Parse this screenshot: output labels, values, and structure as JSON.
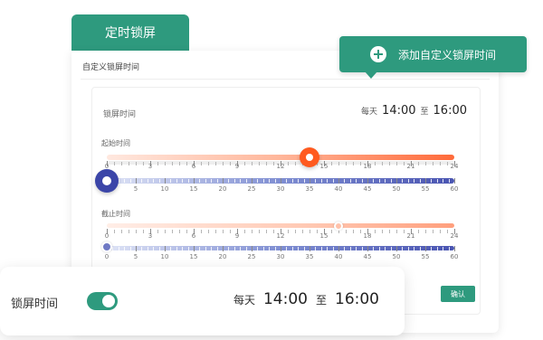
{
  "tab": {
    "title": "定时锁屏"
  },
  "section": {
    "title": "自定义锁屏时间"
  },
  "panel": {
    "label": "锁屏时间",
    "daily": "每天",
    "start": "14:00",
    "to": "至",
    "end": "16:00"
  },
  "start_slider": {
    "title": "起始时间",
    "hour_ticks": [
      "0",
      "3",
      "6",
      "9",
      "12",
      "15",
      "18",
      "21",
      "24"
    ],
    "minute_ticks": [
      "0",
      "5",
      "10",
      "15",
      "20",
      "25",
      "30",
      "35",
      "40",
      "45",
      "50",
      "55",
      "60"
    ],
    "hour_value": 14,
    "minute_value": 0
  },
  "end_slider": {
    "title": "截止时间",
    "hour_ticks": [
      "0",
      "3",
      "6",
      "9",
      "12",
      "15",
      "18",
      "21",
      "24"
    ],
    "minute_ticks": [
      "0",
      "5",
      "10",
      "15",
      "20",
      "25",
      "30",
      "35",
      "40",
      "45",
      "50",
      "55",
      "60"
    ],
    "hour_value": 16,
    "minute_value": 0
  },
  "confirm": {
    "label": "确认"
  },
  "add_button": {
    "label": "添加自定义锁屏时间",
    "icon": "plus-icon"
  },
  "float_card": {
    "label": "锁屏时间",
    "toggle_on": true,
    "daily": "每天",
    "start": "14:00",
    "to": "至",
    "end": "16:00"
  },
  "colors": {
    "accent_green": "#2e9a7e",
    "orange": "#ff5a1f",
    "blue": "#3b45a8"
  }
}
